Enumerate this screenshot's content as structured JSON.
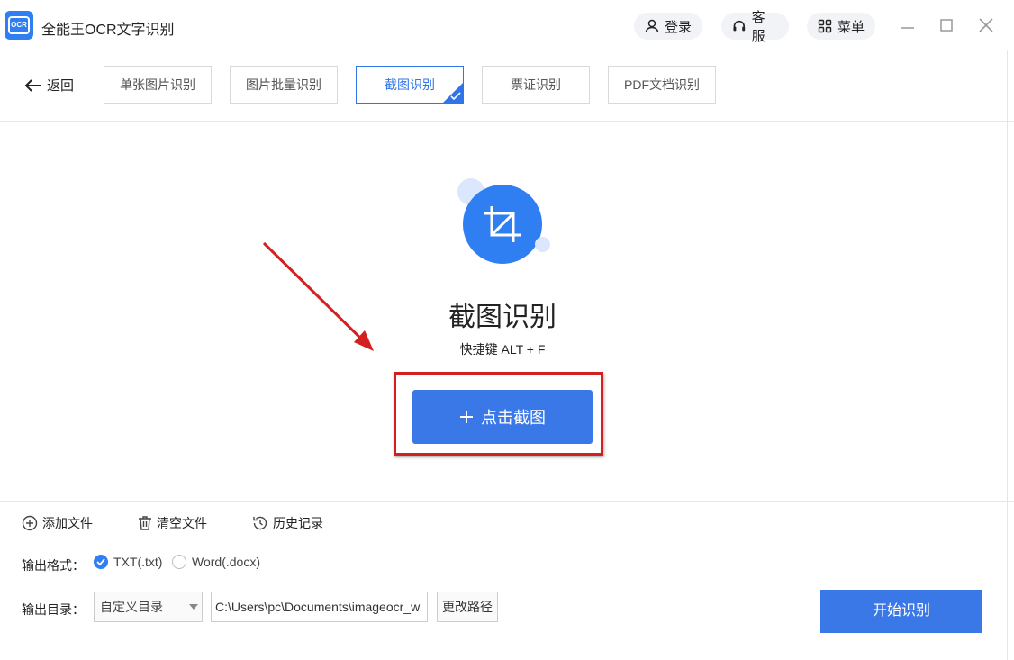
{
  "app": {
    "logo_text": "OCR",
    "title": "全能王OCR文字识别"
  },
  "header": {
    "login": "登录",
    "service": "客服",
    "menu": "菜单"
  },
  "nav": {
    "back": "返回",
    "tabs": [
      {
        "label": "单张图片识别"
      },
      {
        "label": "图片批量识别"
      },
      {
        "label": "截图识别",
        "active": true
      },
      {
        "label": "票证识别"
      },
      {
        "label": "PDF文档识别"
      }
    ]
  },
  "main": {
    "title": "截图识别",
    "hint": "快捷键 ALT + F",
    "capture_button": "点击截图"
  },
  "footer": {
    "add_files": "添加文件",
    "clear_files": "清空文件",
    "history": "历史记录",
    "format_label": "输出格式：",
    "format_txt": "TXT(.txt)",
    "format_word": "Word(.docx)",
    "format_selected": "TXT(.txt)",
    "dir_label": "输出目录：",
    "dir_select": "自定义目录",
    "dir_path": "C:\\Users\\pc\\Documents\\imageocr_w",
    "change_path": "更改路径",
    "start": "开始识别"
  },
  "colors": {
    "accent": "#2f7ff3",
    "button": "#3b78e7",
    "highlight": "#d02020"
  },
  "icons": [
    "ocr-logo-icon",
    "user-icon",
    "headset-icon",
    "grid-icon",
    "minimize-icon",
    "maximize-icon",
    "close-icon",
    "back-arrow-icon",
    "check-icon",
    "crop-icon",
    "plus-icon",
    "plus-circle-icon",
    "trash-icon",
    "history-icon",
    "arrow-annotation-icon"
  ]
}
